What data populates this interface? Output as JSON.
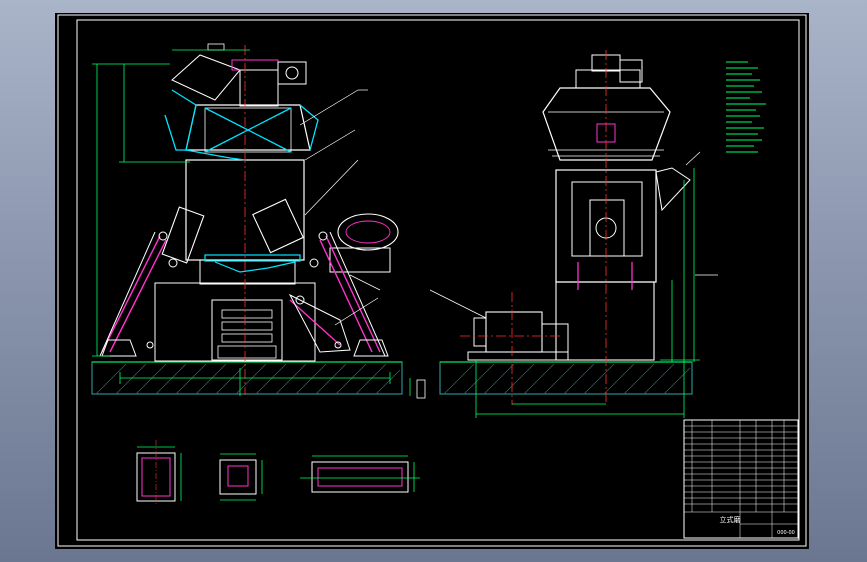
{
  "drawing": {
    "title_block": {
      "drawing_name": "立式磨",
      "drawing_no": "000-00"
    }
  },
  "colors": {
    "background": "#000000",
    "frame": "#ffffff",
    "outline": "#ffffff",
    "dimension": "#00ff66",
    "centerline": "#ff3030",
    "cyan_part": "#00e5ff",
    "magenta_part": "#ff33cc",
    "hatch": "#2a8c8c",
    "yellow_text": "#ffff00"
  }
}
